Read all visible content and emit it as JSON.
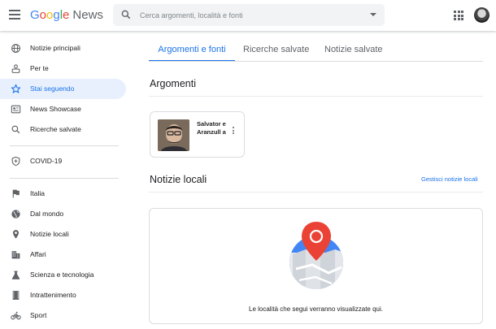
{
  "header": {
    "logo_google": "Google",
    "logo_news": "News",
    "search_placeholder": "Cerca argomenti, località e fonti"
  },
  "sidebar": {
    "items": [
      {
        "label": "Notizie principali",
        "icon": "globe-icon"
      },
      {
        "label": "Per te",
        "icon": "person-icon"
      },
      {
        "label": "Stai seguendo",
        "icon": "star-icon",
        "active": true
      },
      {
        "label": "News Showcase",
        "icon": "showcase-icon"
      },
      {
        "label": "Ricerche salvate",
        "icon": "search-icon"
      },
      {
        "label": "COVID-19",
        "icon": "shield-icon"
      },
      {
        "label": "Italia",
        "icon": "flag-icon"
      },
      {
        "label": "Dal mondo",
        "icon": "world-icon"
      },
      {
        "label": "Notizie locali",
        "icon": "pin-icon"
      },
      {
        "label": "Affari",
        "icon": "building-icon"
      },
      {
        "label": "Scienza e tecnologia",
        "icon": "flask-icon"
      },
      {
        "label": "Intrattenimento",
        "icon": "film-icon"
      },
      {
        "label": "Sport",
        "icon": "bike-icon"
      }
    ]
  },
  "tabs": [
    {
      "label": "Argomenti e fonti",
      "active": true
    },
    {
      "label": "Ricerche salvate"
    },
    {
      "label": "Notizie salvate"
    }
  ],
  "main": {
    "topics_title": "Argomenti",
    "topic_name": "Salvator e Aranzull a",
    "local_title": "Notizie locali",
    "manage_link": "Gestisci notizie locali",
    "local_empty_text": "Le località che segui verranno visualizzate qui."
  },
  "colors": {
    "accent": "#1a73e8",
    "active_bg": "#e8f0fe"
  }
}
